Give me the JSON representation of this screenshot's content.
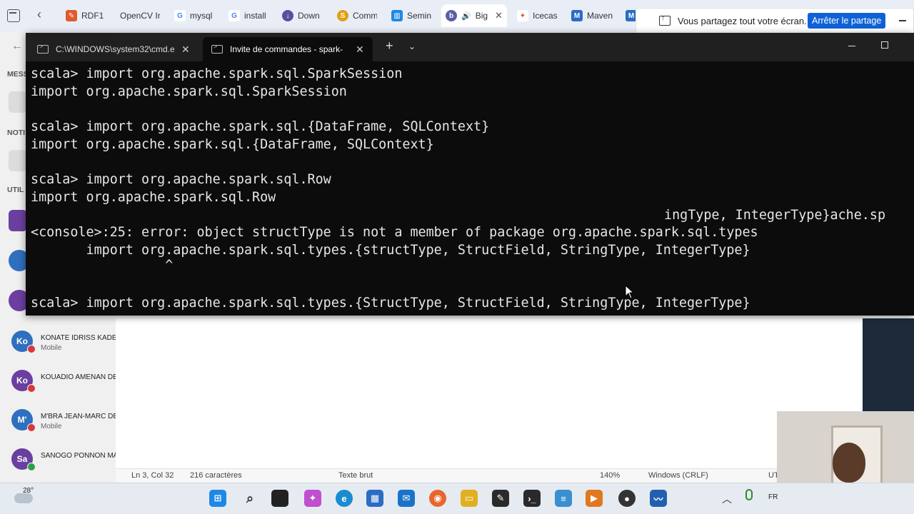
{
  "browser": {
    "tabs": [
      {
        "label": "RDF1",
        "icon": "rdf-icon",
        "color": "#e05a2b"
      },
      {
        "label": "OpenCV Ir",
        "icon": "opencv-icon",
        "color": "#cccccc"
      },
      {
        "label": "mysql",
        "icon": "google-icon",
        "color": "#4285f4"
      },
      {
        "label": "install",
        "icon": "google-icon",
        "color": "#4285f4"
      },
      {
        "label": "Down",
        "icon": "download-icon",
        "color": "#5a4ea0"
      },
      {
        "label": "Comm",
        "icon": "comm-icon",
        "color": "#e0a010"
      },
      {
        "label": "Semin",
        "icon": "semin-icon",
        "color": "#1e88e5"
      },
      {
        "label": "Big",
        "icon": "bing-icon",
        "color": "#5b5ea6",
        "active": true,
        "close": "✕"
      },
      {
        "label": "Icecas",
        "icon": "icecast-icon",
        "color": "#e05020"
      },
      {
        "label": "Maven",
        "icon": "maven-icon",
        "color": "#2b6cc4"
      }
    ]
  },
  "share_banner": {
    "text": "Vous partagez tout votre écran.",
    "button": "Arrêter le partage"
  },
  "sidebar": {
    "sections": [
      "MESS",
      "NOTI",
      "UTIL"
    ],
    "contacts": [
      {
        "initials": "Ko",
        "name": "KONATE IDRISS KADER",
        "status": "Mobile",
        "color": "#2f6fbf"
      },
      {
        "initials": "Ko",
        "name": "KOUADIO AMENAN DE",
        "status": "",
        "color": "#6b3fa0"
      },
      {
        "initials": "M'",
        "name": "M'BRA JEAN-MARC DE",
        "status": "Mobile",
        "color": "#2f6fbf"
      },
      {
        "initials": "Sa",
        "name": "SANOGO PONNON MA",
        "status": "",
        "color": "#6b3fa0"
      }
    ]
  },
  "terminal": {
    "tabs": [
      {
        "label": "C:\\WINDOWS\\system32\\cmd.e"
      },
      {
        "label": "Invite de commandes - spark-",
        "active": true
      }
    ],
    "lines": [
      "scala> import org.apache.spark.sql.SparkSession",
      "import org.apache.spark.sql.SparkSession",
      "",
      "scala> import org.apache.spark.sql.{DataFrame, SQLContext}",
      "import org.apache.spark.sql.{DataFrame, SQLContext}",
      "",
      "scala> import org.apache.spark.sql.Row",
      "import org.apache.spark.sql.Row",
      "",
      "<console>:25: error: object structType is not a member of package org.apache.spark.sql.types",
      "       import org.apache.spark.sql.types.{structType, StructField, StringType, IntegerType}",
      "                 ^",
      "",
      "scala> import org.apache.spark.sql.types.{StructType, StructField, StringType, IntegerType}"
    ],
    "overlap_text": "ingType, IntegerType}ache.sp"
  },
  "notepad": {
    "position": "Ln 3, Col 32",
    "chars": "216 caractères",
    "format": "Texte brut",
    "zoom": "140%",
    "eol": "Windows (CRLF)",
    "enc": "UT"
  },
  "taskbar": {
    "temperature": "28°",
    "lang": "FR",
    "apps": [
      {
        "icon": "start-icon",
        "color": "#1e88e5"
      },
      {
        "icon": "search-icon",
        "color": "#333333"
      },
      {
        "icon": "taskview-icon",
        "color": "#222222"
      },
      {
        "icon": "copilot-icon",
        "color": "#c04fd0"
      },
      {
        "icon": "edge-icon",
        "color": "#1a8ccf"
      },
      {
        "icon": "store-icon",
        "color": "#2b6cc4"
      },
      {
        "icon": "outlook-icon",
        "color": "#1a73c8"
      },
      {
        "icon": "firefox-icon",
        "color": "#e8662b"
      },
      {
        "icon": "explorer-icon",
        "color": "#e0b020"
      },
      {
        "icon": "notes-icon",
        "color": "#2a2a2a"
      },
      {
        "icon": "terminal-icon",
        "color": "#2a2a2a"
      },
      {
        "icon": "notepad-icon",
        "color": "#3a8fd0"
      },
      {
        "icon": "media-icon",
        "color": "#e07820"
      },
      {
        "icon": "recorder-icon",
        "color": "#333333"
      },
      {
        "icon": "teams-icon",
        "color": "#2060b0"
      }
    ]
  }
}
